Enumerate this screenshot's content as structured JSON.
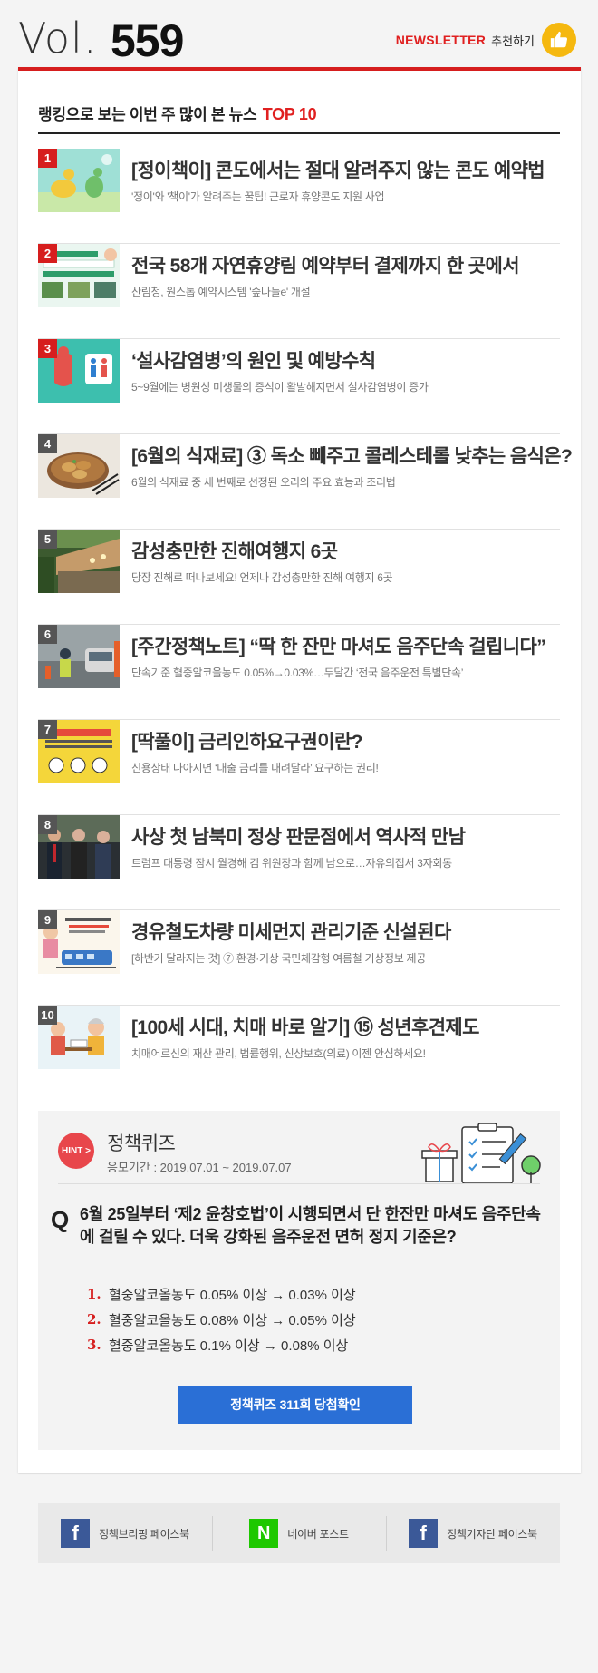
{
  "header": {
    "vol_prefix": "Vol.",
    "vol_number": "559",
    "newsletter_label": "NEWSLETTER",
    "recommend_label": "추천하기",
    "thumb_icon": "thumbs-up-icon"
  },
  "ranking": {
    "heading": "랭킹으로 보는 이번 주 많이 본 뉴스",
    "heading_accent": "TOP 10",
    "items": [
      {
        "rank": "1",
        "title": "[정이책이] 콘도에서는 절대 알려주지 않는 콘도 예약법",
        "desc": "'정이'와 '책이'가 알려주는 꿀팁! 근로자 휴양콘도 지원 사업"
      },
      {
        "rank": "2",
        "title": "전국 58개 자연휴양림 예약부터 결제까지 한 곳에서",
        "desc": "산림청, 원스톱 예약시스템 '숲나들e' 개설"
      },
      {
        "rank": "3",
        "title": "‘설사감염병’의 원인 및 예방수칙",
        "desc": "5~9월에는 병원성 미생물의 증식이 활발해지면서 설사감염병이 증가"
      },
      {
        "rank": "4",
        "title": "[6월의 식재료] ③ 독소 빼주고 콜레스테롤 낮추는 음식은?",
        "desc": "6월의 식재료 중 세 번째로 선정된 오리의 주요 효능과 조리법"
      },
      {
        "rank": "5",
        "title": "감성충만한 진해여행지 6곳",
        "desc": "당장 진해로 떠나보세요! 언제나 감성충만한 진해 여행지 6곳"
      },
      {
        "rank": "6",
        "title": "[주간정책노트] “딱 한 잔만 마셔도 음주단속 걸립니다”",
        "desc": "단속기준 혈중알코올농도 0.05%→0.03%…두달간 ‘전국 음주운전 특별단속’"
      },
      {
        "rank": "7",
        "title": "[딱풀이] 금리인하요구권이란?",
        "desc": "신용상태 나아지면 ‘대출 금리를 내려달라’ 요구하는 권리!"
      },
      {
        "rank": "8",
        "title": "사상 첫 남북미 정상 판문점에서 역사적 만남",
        "desc": "트럼프 대통령 잠시 월경해 김 위원장과 함께 남으로…자유의집서 3자회동"
      },
      {
        "rank": "9",
        "title": "경유철도차량 미세먼지 관리기준 신설된다",
        "desc": "[하반기 달라지는 것] ⑦ 환경·기상 국민체감형 여름철 기상정보 제공"
      },
      {
        "rank": "10",
        "title": "[100세 시대, 치매 바로 알기] ⑮ 성년후견제도",
        "desc": "치매어르신의 재산 관리, 법률행위, 신상보호(의료) 이젠 안심하세요!"
      }
    ]
  },
  "quiz": {
    "hint_label": "HINT >",
    "title": "정책퀴즈",
    "period": "응모기간 : 2019.07.01 ~ 2019.07.07",
    "q_mark": "Q",
    "question": "6월 25일부터 ‘제2 윤창호법’이 시행되면서 단 한잔만 마셔도 음주단속에 걸릴 수 있다. 더욱 강화된 음주운전 면허 정지 기준은?",
    "options": [
      {
        "num": "1.",
        "text": "혈중알코올농도 0.05% 이상 → 0.03% 이상"
      },
      {
        "num": "2.",
        "text": "혈중알코올농도 0.08% 이상 → 0.05% 이상"
      },
      {
        "num": "3.",
        "text": "혈중알코올농도 0.1% 이상 → 0.08% 이상"
      }
    ],
    "button": "정책퀴즈 311회 당첨확인"
  },
  "footer": {
    "links": [
      {
        "icon": "facebook-icon",
        "glyph": "f",
        "label": "정책브리핑 페이스북"
      },
      {
        "icon": "naver-icon",
        "glyph": "N",
        "label": "네이버 포스트"
      },
      {
        "icon": "facebook-icon",
        "glyph": "f",
        "label": "정책기자단 페이스북"
      }
    ]
  },
  "colors": {
    "accent_red": "#d61e1e",
    "button_blue": "#2a6fd6",
    "thumb_yellow": "#f5b80f",
    "facebook_blue": "#3b5998",
    "naver_green": "#1ec800"
  }
}
